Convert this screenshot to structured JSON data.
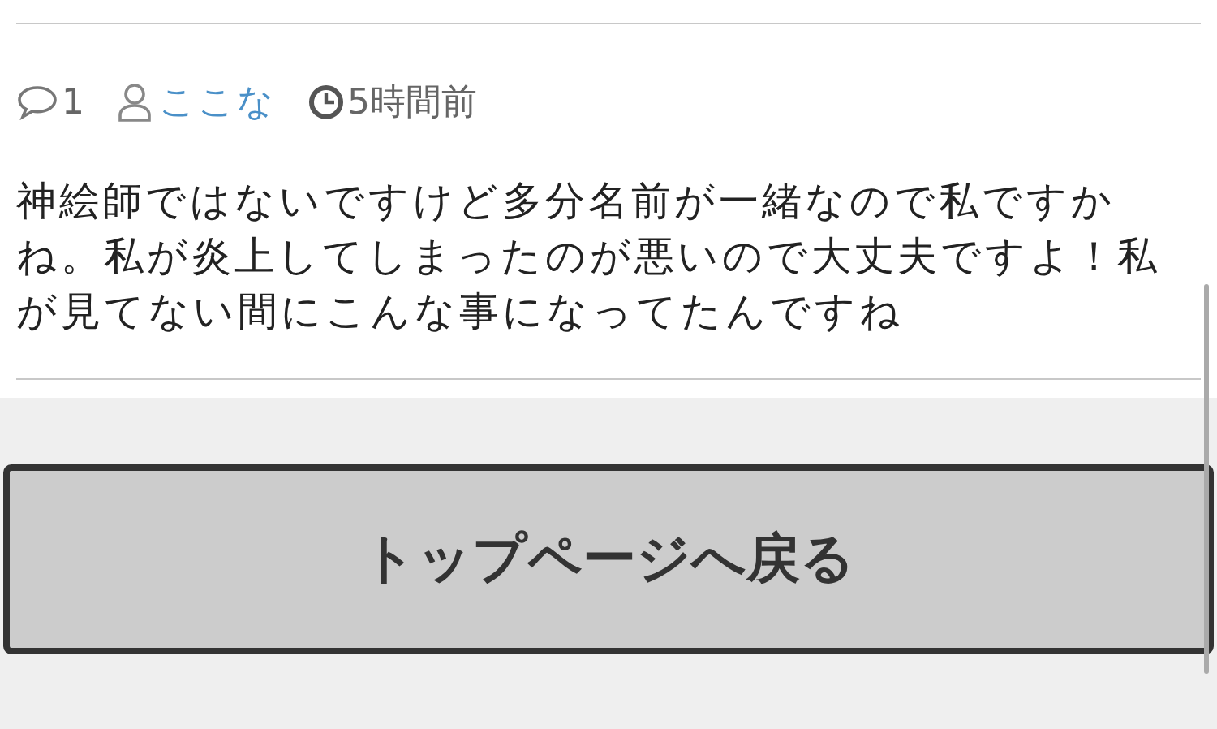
{
  "comment": {
    "reply_count": "1",
    "author": "ここな",
    "time": "5時間前",
    "body": "神絵師ではないですけど多分名前が一緒なので私ですかね。私が炎上してしまったのが悪いので大丈夫ですよ！私が見てない間にこんな事になってたんですね"
  },
  "back_button": {
    "label": "トップページへ戻る"
  }
}
